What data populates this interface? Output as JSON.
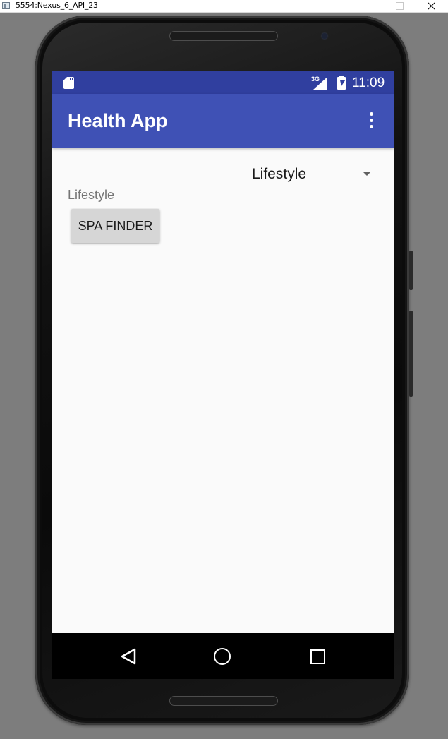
{
  "window": {
    "title": "5554:Nexus_6_API_23"
  },
  "status_bar": {
    "network": "3G",
    "time": "11:09",
    "icons": [
      "sd-card-icon",
      "signal-icon",
      "battery-charging-icon"
    ]
  },
  "toolbar": {
    "title": "Health App",
    "overflow_icon": "more-vert-icon"
  },
  "content": {
    "spinner_value": "Lifestyle",
    "category_label": "Lifestyle",
    "spa_button_label": "SPA FINDER"
  },
  "nav_bar": {
    "icons": [
      "back-icon",
      "home-icon",
      "recents-icon"
    ]
  },
  "colors": {
    "status_bar": "#303f9f",
    "toolbar": "#3f51b5",
    "background": "#fafafa",
    "button": "#d6d6d6"
  }
}
